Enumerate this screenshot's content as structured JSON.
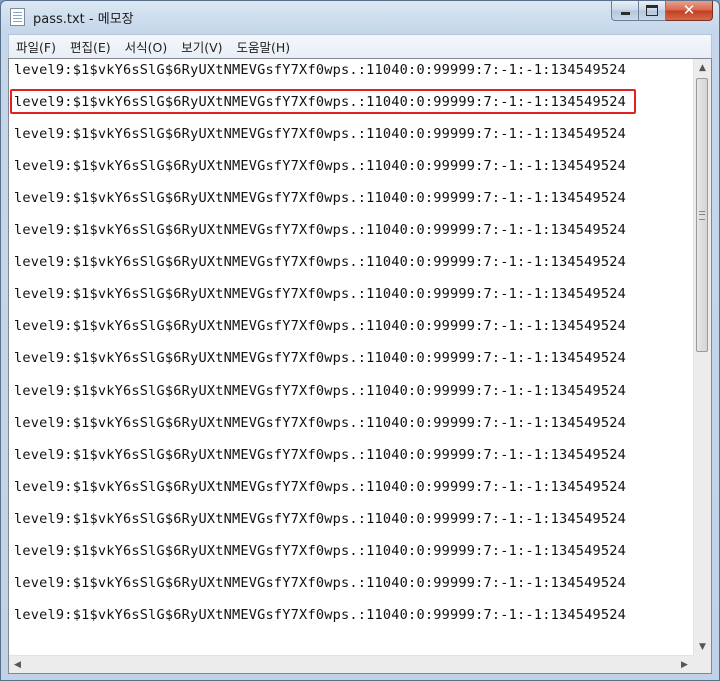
{
  "window": {
    "title": "pass.txt - 메모장",
    "icon": "notepad-icon",
    "controls": {
      "minimize_icon": "minimize-icon",
      "maximize_icon": "maximize-icon",
      "close_icon": "close-icon",
      "close_glyph": "✕"
    }
  },
  "menu": {
    "items": [
      {
        "label": "파일(F)"
      },
      {
        "label": "편집(E)"
      },
      {
        "label": "서식(O)"
      },
      {
        "label": "보기(V)"
      },
      {
        "label": "도움말(H)"
      }
    ]
  },
  "editor": {
    "lines": [
      "level9:$1$vkY6sSlG$6RyUXtNMEVGsfY7Xf0wps.:11040:0:99999:7:-1:-1:134549524",
      "level9:$1$vkY6sSlG$6RyUXtNMEVGsfY7Xf0wps.:11040:0:99999:7:-1:-1:134549524",
      "level9:$1$vkY6sSlG$6RyUXtNMEVGsfY7Xf0wps.:11040:0:99999:7:-1:-1:134549524",
      "level9:$1$vkY6sSlG$6RyUXtNMEVGsfY7Xf0wps.:11040:0:99999:7:-1:-1:134549524",
      "level9:$1$vkY6sSlG$6RyUXtNMEVGsfY7Xf0wps.:11040:0:99999:7:-1:-1:134549524",
      "level9:$1$vkY6sSlG$6RyUXtNMEVGsfY7Xf0wps.:11040:0:99999:7:-1:-1:134549524",
      "level9:$1$vkY6sSlG$6RyUXtNMEVGsfY7Xf0wps.:11040:0:99999:7:-1:-1:134549524",
      "level9:$1$vkY6sSlG$6RyUXtNMEVGsfY7Xf0wps.:11040:0:99999:7:-1:-1:134549524",
      "level9:$1$vkY6sSlG$6RyUXtNMEVGsfY7Xf0wps.:11040:0:99999:7:-1:-1:134549524",
      "level9:$1$vkY6sSlG$6RyUXtNMEVGsfY7Xf0wps.:11040:0:99999:7:-1:-1:134549524",
      "level9:$1$vkY6sSlG$6RyUXtNMEVGsfY7Xf0wps.:11040:0:99999:7:-1:-1:134549524",
      "level9:$1$vkY6sSlG$6RyUXtNMEVGsfY7Xf0wps.:11040:0:99999:7:-1:-1:134549524",
      "level9:$1$vkY6sSlG$6RyUXtNMEVGsfY7Xf0wps.:11040:0:99999:7:-1:-1:134549524",
      "level9:$1$vkY6sSlG$6RyUXtNMEVGsfY7Xf0wps.:11040:0:99999:7:-1:-1:134549524",
      "level9:$1$vkY6sSlG$6RyUXtNMEVGsfY7Xf0wps.:11040:0:99999:7:-1:-1:134549524",
      "level9:$1$vkY6sSlG$6RyUXtNMEVGsfY7Xf0wps.:11040:0:99999:7:-1:-1:134549524",
      "level9:$1$vkY6sSlG$6RyUXtNMEVGsfY7Xf0wps.:11040:0:99999:7:-1:-1:134549524",
      "level9:$1$vkY6sSlG$6RyUXtNMEVGsfY7Xf0wps.:11040:0:99999:7:-1:-1:134549524"
    ],
    "highlighted_line": 2,
    "highlight_color": "#e0221e"
  },
  "scrollbars": {
    "up_arrow": "▲",
    "down_arrow": "▼",
    "left_arrow": "◀",
    "right_arrow": "▶"
  }
}
